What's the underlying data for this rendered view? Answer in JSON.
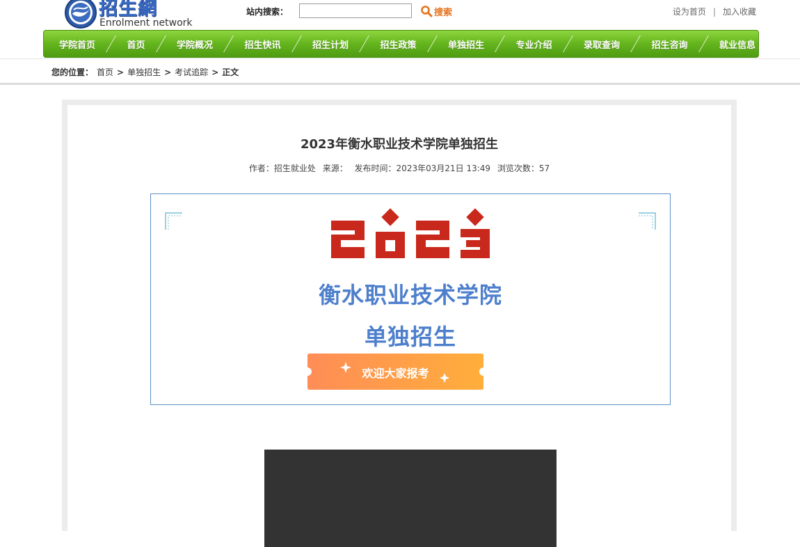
{
  "header": {
    "logo_cn": "招生網",
    "logo_en": "Enrolment network",
    "search_label": "站内搜索：",
    "search_value": "",
    "search_button": "搜索",
    "top_links": [
      "设为首页",
      "加入收藏"
    ],
    "top_links_separator": "|"
  },
  "nav": {
    "items": [
      "学院首页",
      "首页",
      "学院概况",
      "招生快讯",
      "招生计划",
      "招生政策",
      "单独招生",
      "专业介绍",
      "录取查询",
      "招生咨询",
      "就业信息"
    ]
  },
  "breadcrumb": {
    "label": "您的位置：",
    "items": [
      "首页",
      "单独招生",
      "考试追踪",
      "正文"
    ],
    "separator": ">"
  },
  "article": {
    "title": "2023年衡水职业技术学院单独招生",
    "meta_author": "作者：招生就业处",
    "meta_source": "来源：",
    "meta_time": "发布时间：2023年03月21日 13:49",
    "meta_views": "浏览次数：57"
  },
  "banner": {
    "year": "2023",
    "line1": "衡水职业技术学院",
    "line2": "单独招生",
    "welcome": "欢迎大家报考"
  },
  "colors": {
    "nav_green": "#64b41d",
    "banner_blue": "#4d7fcc",
    "year_red": "#c8291c",
    "ribbon_orange": "#ff9a4a",
    "search_orange": "#e4731e",
    "video_dark": "#333333"
  }
}
